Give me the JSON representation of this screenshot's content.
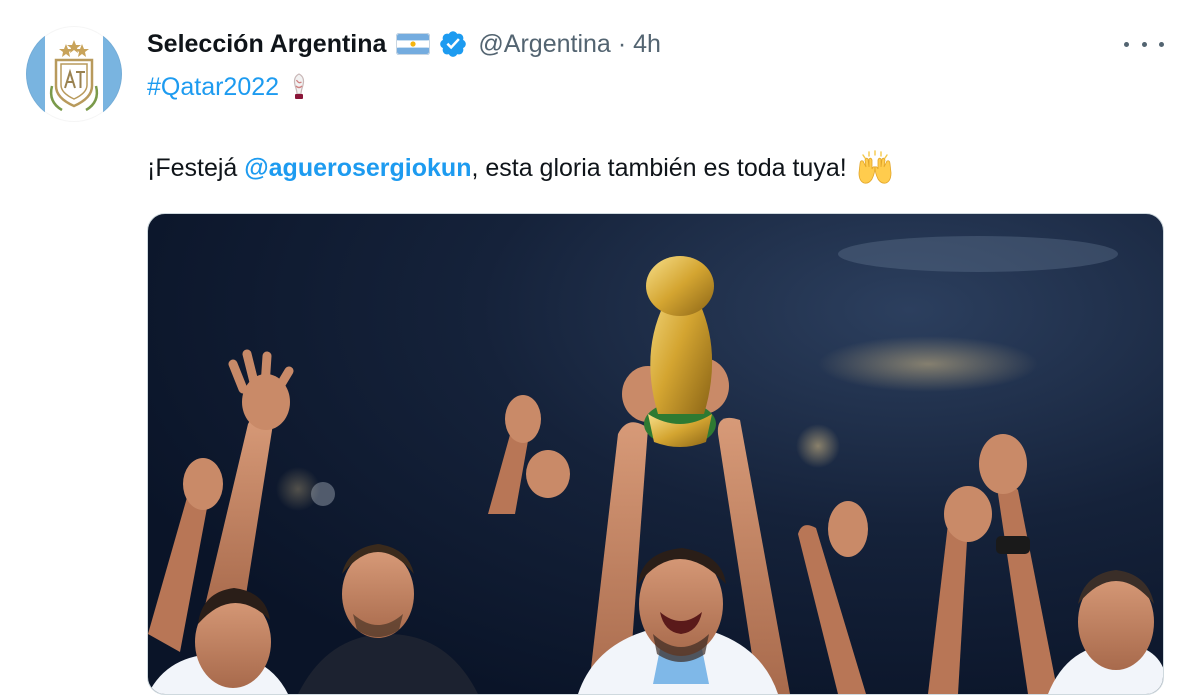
{
  "tweet": {
    "author_name": "Selección Argentina",
    "handle": "@Argentina",
    "separator": "·",
    "time": "4h",
    "hashtag": "#Qatar2022",
    "text_prefix": "¡Festejá ",
    "mention": "@aguerosergiokun",
    "text_suffix": ", esta gloria también es toda tuya!",
    "icons": {
      "avatar": "afa-crest-icon",
      "flag": "argentina-flag-icon",
      "verified": "verified-badge-icon",
      "more": "more-options-icon",
      "hashtag_emoji": "world-cup-trophy-icon",
      "text_emoji": "raising-hands-icon"
    },
    "media": {
      "alt": "photo"
    }
  },
  "colors": {
    "link": "#1d9bf0",
    "secondary_text": "#536471",
    "primary_text": "#0f1419",
    "verified": "#1d9bf0"
  }
}
